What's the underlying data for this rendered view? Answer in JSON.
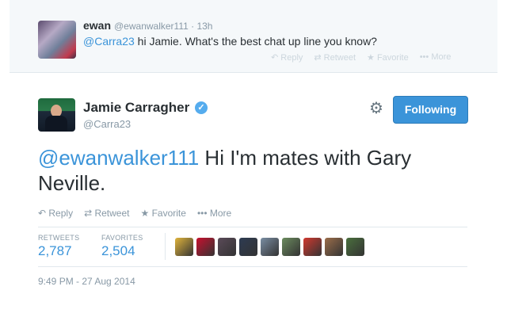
{
  "reply": {
    "name": "ewan",
    "handle": "@ewanwalker111 · 13h",
    "mention": "@Carra23",
    "text": " hi Jamie. What's the best chat up line you know?",
    "actions": {
      "reply": "↶ Reply",
      "retweet": "⇄ Retweet",
      "favorite": "★ Favorite",
      "more": "••• More"
    }
  },
  "tweet": {
    "name": "Jamie Carragher",
    "verified_mark": "✓",
    "handle": "@Carra23",
    "follow_label": "Following",
    "gear_glyph": "⚙",
    "mention": "@ewanwalker111",
    "text": " Hi I'm  mates with Gary Neville.",
    "actions": {
      "reply": "↶ Reply",
      "retweet": "⇄ Retweet",
      "favorite": "★ Favorite",
      "more": "••• More"
    },
    "stats": {
      "retweets_label": "RETWEETS",
      "retweets_value": "2,787",
      "favorites_label": "FAVORITES",
      "favorites_value": "2,504"
    },
    "favoriter_avatar_colors": [
      "#e0b43c",
      "#c8102e",
      "#5a4a58",
      "#2d3b52",
      "#7a8ea3",
      "#6b8b5e",
      "#d1392f",
      "#9b6d4a",
      "#4a6f3d"
    ],
    "timestamp": "9:49 PM - 27 Aug 2014"
  },
  "colors": {
    "accent": "#3b94d9",
    "muted": "#8899a6",
    "text": "#292f33"
  }
}
